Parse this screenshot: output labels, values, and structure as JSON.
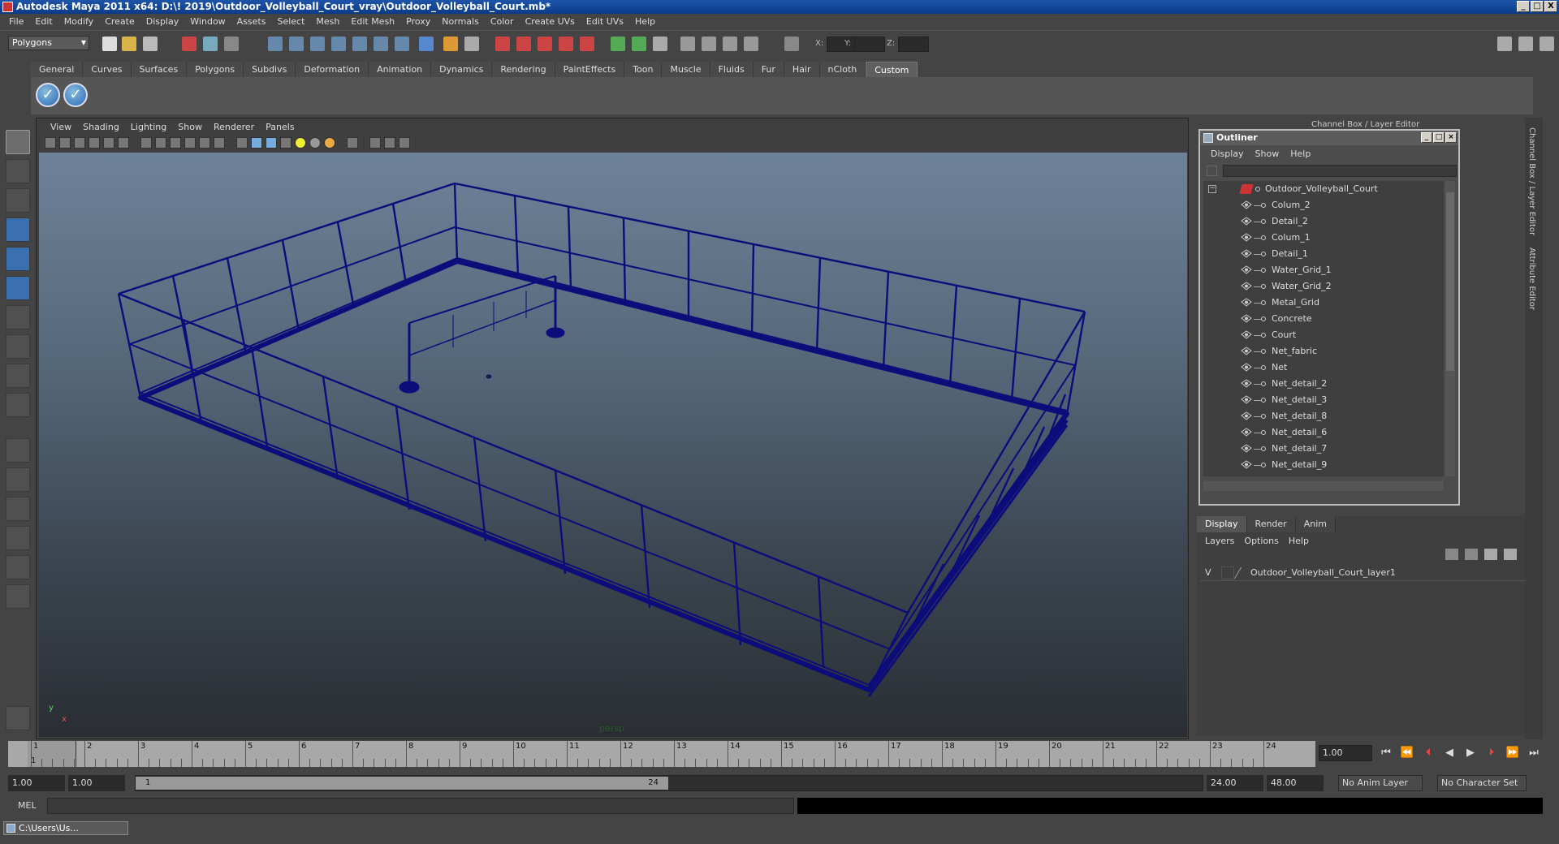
{
  "window": {
    "title": "Autodesk Maya 2011 x64: D:\\! 2019\\Outdoor_Volleyball_Court_vray\\Outdoor_Volleyball_Court.mb*",
    "min": "_",
    "max": "□",
    "close": "X"
  },
  "menubar": [
    "File",
    "Edit",
    "Modify",
    "Create",
    "Display",
    "Window",
    "Assets",
    "Select",
    "Mesh",
    "Edit Mesh",
    "Proxy",
    "Normals",
    "Color",
    "Create UVs",
    "Edit UVs",
    "Help"
  ],
  "statusline": {
    "mode": "Polygons",
    "x_label": "X:",
    "y_label": "Y:",
    "z_label": "Z:"
  },
  "shelf": {
    "tabs": [
      "General",
      "Curves",
      "Surfaces",
      "Polygons",
      "Subdivs",
      "Deformation",
      "Animation",
      "Dynamics",
      "Rendering",
      "PaintEffects",
      "Toon",
      "Muscle",
      "Fluids",
      "Fur",
      "Hair",
      "nCloth",
      "Custom"
    ],
    "active": "Custom"
  },
  "viewport": {
    "menu": [
      "View",
      "Shading",
      "Lighting",
      "Show",
      "Renderer",
      "Panels"
    ],
    "camera": "persp",
    "axis_y": "y",
    "axis_x": "x",
    "wire_color": "#0c0c7a"
  },
  "channel_box": {
    "title": "Channel Box / Layer Editor"
  },
  "outliner": {
    "title": "Outliner",
    "menu": [
      "Display",
      "Show",
      "Help"
    ],
    "root": "Outdoor_Volleyball_Court",
    "items": [
      "Colum_2",
      "Detail_2",
      "Colum_1",
      "Detail_1",
      "Water_Grid_1",
      "Water_Grid_2",
      "Metal_Grid",
      "Concrete",
      "Court",
      "Net_fabric",
      "Net",
      "Net_detail_2",
      "Net_detail_3",
      "Net_detail_8",
      "Net_detail_6",
      "Net_detail_7",
      "Net_detail_9"
    ]
  },
  "layers": {
    "tabs": [
      "Display",
      "Render",
      "Anim"
    ],
    "menu": [
      "Layers",
      "Options",
      "Help"
    ],
    "visible_flag": "V",
    "layer_name": "Outdoor_Volleyball_Court_layer1"
  },
  "side_tabs": [
    "Channel Box / Layer Editor",
    "Attribute Editor"
  ],
  "timeline": {
    "ticks": [
      "1",
      "2",
      "3",
      "4",
      "5",
      "6",
      "7",
      "8",
      "9",
      "10",
      "11",
      "12",
      "13",
      "14",
      "15",
      "16",
      "17",
      "18",
      "19",
      "20",
      "21",
      "22",
      "23",
      "24"
    ],
    "current_label": "1",
    "current_frame": "1.00"
  },
  "range": {
    "start": "1.00",
    "start2": "1.00",
    "thumb_start": "1",
    "thumb_end": "24",
    "end": "24.00",
    "end2": "48.00",
    "anim_layer": "No Anim Layer",
    "char_set": "No Character Set"
  },
  "command": {
    "label": "MEL"
  },
  "taskbar": {
    "item": "C:\\Users\\Us..."
  }
}
